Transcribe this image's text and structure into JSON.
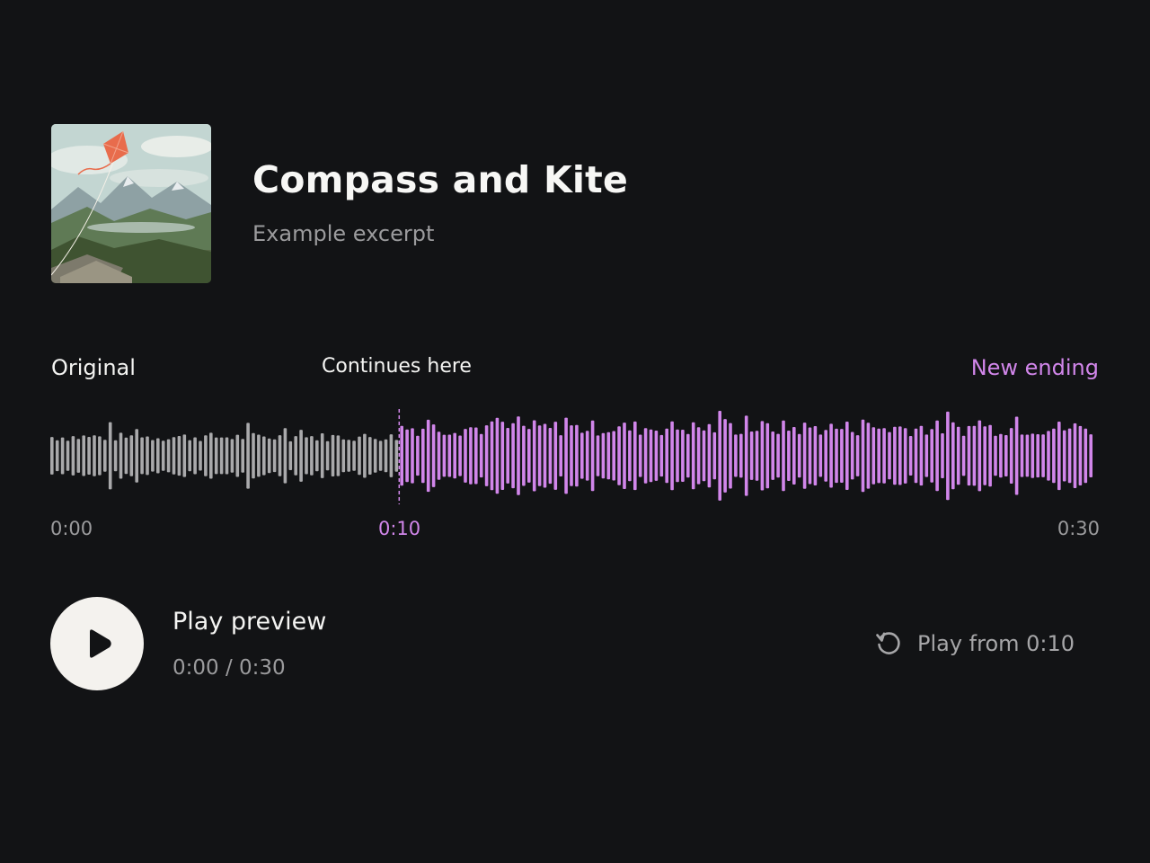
{
  "track": {
    "title": "Compass and Kite",
    "subtitle": "Example excerpt"
  },
  "waveform": {
    "original_label": "Original",
    "continues_label": "Continues here",
    "new_label": "New ending",
    "time_start": "0:00",
    "time_split": "0:10",
    "time_end": "0:30",
    "split_fraction": 0.3333,
    "original_color": "#a9a9ab",
    "new_color": "#d186ea"
  },
  "player": {
    "play_label": "Play preview",
    "time_display": "0:00 / 0:30",
    "replay_label": "Play from 0:10"
  },
  "icons": {
    "play": "play-icon",
    "replay": "replay-icon"
  },
  "colors": {
    "background": "#121315",
    "accent": "#d186ea",
    "muted": "#9b9b9d",
    "button": "#f4f2ee"
  }
}
